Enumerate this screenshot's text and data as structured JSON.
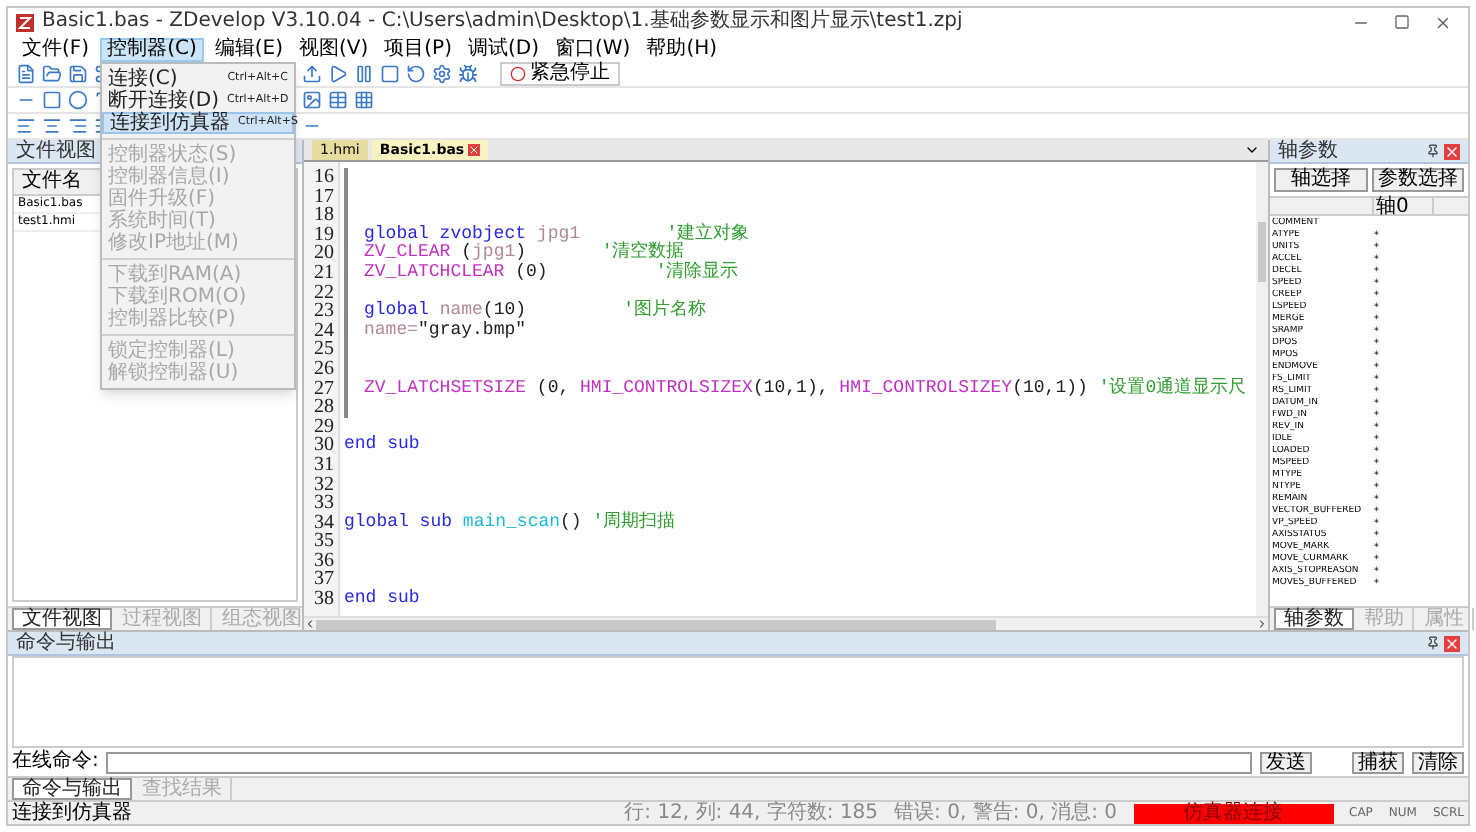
{
  "window": {
    "title": "Basic1.bas - ZDevelop V3.10.04 - C:\\Users\\admin\\Desktop\\1.基础参数显示和图片显示\\test1.zpj"
  },
  "menu_bar": [
    {
      "label": "文件(F)",
      "selected": false
    },
    {
      "label": "控制器(C)",
      "selected": true
    },
    {
      "label": "编辑(E)",
      "selected": false
    },
    {
      "label": "视图(V)",
      "selected": false
    },
    {
      "label": "项目(P)",
      "selected": false
    },
    {
      "label": "调试(D)",
      "selected": false
    },
    {
      "label": "窗口(W)",
      "selected": false
    },
    {
      "label": "帮助(H)",
      "selected": false
    }
  ],
  "dropdown_menu": {
    "groups": [
      [
        {
          "label": "连接(C)",
          "shortcut": "Ctrl+Alt+C",
          "disabled": false,
          "selected": false
        },
        {
          "label": "断开连接(D)",
          "shortcut": "Ctrl+Alt+D",
          "disabled": false,
          "selected": false
        },
        {
          "label": "连接到仿真器",
          "shortcut": "Ctrl+Alt+S",
          "disabled": false,
          "selected": true
        }
      ],
      [
        {
          "label": "控制器状态(S)",
          "disabled": true,
          "selected": false
        },
        {
          "label": "控制器信息(I)",
          "disabled": true,
          "selected": false
        },
        {
          "label": "固件升级(F)",
          "disabled": true,
          "selected": false
        },
        {
          "label": "系统时间(T)",
          "disabled": true,
          "selected": false
        },
        {
          "label": "修改IP地址(M)",
          "disabled": true,
          "selected": false
        }
      ],
      [
        {
          "label": "下载到RAM(A)",
          "disabled": true,
          "selected": false
        },
        {
          "label": "下载到ROM(O)",
          "disabled": true,
          "selected": false
        },
        {
          "label": "控制器比较(P)",
          "disabled": true,
          "selected": false
        }
      ],
      [
        {
          "label": "锁定控制器(L)",
          "disabled": true,
          "selected": false
        },
        {
          "label": "解锁控制器(U)",
          "disabled": true,
          "selected": false
        }
      ]
    ]
  },
  "toolbar": {
    "emergency_stop": "紧急停止"
  },
  "file_panel": {
    "title": "文件视图",
    "column": "文件名",
    "files": [
      "Basic1.bas",
      "test1.hmi"
    ],
    "tabs": [
      {
        "label": "文件视图",
        "selected": true
      },
      {
        "label": "过程视图",
        "selected": false
      },
      {
        "label": "组态视图",
        "selected": false
      }
    ]
  },
  "editor": {
    "tabs": [
      {
        "label": "1.hmi",
        "selected": false,
        "closable": false
      },
      {
        "label": "Basic1.bas",
        "selected": true,
        "closable": true
      }
    ],
    "lines": [
      {
        "number": "16",
        "indented": true
      },
      {
        "number": "17",
        "indented": true
      },
      {
        "number": "18",
        "indented": true
      },
      {
        "number": "19",
        "indented": true,
        "tokens": [
          {
            "text": "global zvobject ",
            "kind": "keyword"
          },
          {
            "text": "jpg1        ",
            "kind": "ident"
          },
          {
            "text": "'建立对象",
            "kind": "comment"
          }
        ]
      },
      {
        "number": "20",
        "indented": true,
        "tokens": [
          {
            "text": "ZV_CLEAR ",
            "kind": "function"
          },
          {
            "text": "(",
            "kind": "plain"
          },
          {
            "text": "jpg1",
            "kind": "ident"
          },
          {
            "text": ")       ",
            "kind": "plain"
          },
          {
            "text": "'清空数据",
            "kind": "comment"
          }
        ]
      },
      {
        "number": "21",
        "indented": true,
        "tokens": [
          {
            "text": "ZV_LATCHCLEAR ",
            "kind": "function"
          },
          {
            "text": "(0)          ",
            "kind": "plain"
          },
          {
            "text": "'清除显示",
            "kind": "comment"
          }
        ]
      },
      {
        "number": "22",
        "indented": true
      },
      {
        "number": "23",
        "indented": true,
        "tokens": [
          {
            "text": "global ",
            "kind": "keyword"
          },
          {
            "text": "name",
            "kind": "ident"
          },
          {
            "text": "(10)         ",
            "kind": "plain"
          },
          {
            "text": "'图片名称",
            "kind": "comment"
          }
        ]
      },
      {
        "number": "24",
        "indented": true,
        "tokens": [
          {
            "text": "name=",
            "kind": "ident"
          },
          {
            "text": "\"gray.bmp\"",
            "kind": "plain"
          }
        ]
      },
      {
        "number": "25",
        "indented": true
      },
      {
        "number": "26",
        "indented": true
      },
      {
        "number": "27",
        "indented": true,
        "tokens": [
          {
            "text": "ZV_LATCHSETSIZE ",
            "kind": "function"
          },
          {
            "text": "(0, ",
            "kind": "plain"
          },
          {
            "text": "HMI_CONTROLSIZEX",
            "kind": "function"
          },
          {
            "text": "(10,1), ",
            "kind": "plain"
          },
          {
            "text": "HMI_CONTROLSIZEY",
            "kind": "function"
          },
          {
            "text": "(10,1)) ",
            "kind": "plain"
          },
          {
            "text": "'设置0通道显示尺",
            "kind": "comment"
          }
        ]
      },
      {
        "number": "28",
        "indented": true
      },
      {
        "number": "29",
        "indented": false
      },
      {
        "number": "30",
        "indented": false,
        "tokens": [
          {
            "text": "end sub",
            "kind": "keyword"
          }
        ]
      },
      {
        "number": "31",
        "indented": false
      },
      {
        "number": "32",
        "indented": false
      },
      {
        "number": "33",
        "indented": false
      },
      {
        "number": "34",
        "indented": false,
        "tokens": [
          {
            "text": "global sub ",
            "kind": "keyword"
          },
          {
            "text": "main_scan",
            "kind": "name"
          },
          {
            "text": "() ",
            "kind": "plain"
          },
          {
            "text": "'周期扫描",
            "kind": "comment"
          }
        ]
      },
      {
        "number": "35",
        "indented": false
      },
      {
        "number": "36",
        "indented": false
      },
      {
        "number": "37",
        "indented": false
      },
      {
        "number": "38",
        "indented": false,
        "tokens": [
          {
            "text": "end sub",
            "kind": "keyword"
          }
        ]
      }
    ]
  },
  "axis_panel": {
    "title": "轴参数",
    "buttons": [
      "轴选择",
      "参数选择"
    ],
    "column": "轴0",
    "params": [
      {
        "name": "COMMENT"
      },
      {
        "name": "ATYPE",
        "value": "*"
      },
      {
        "name": "UNITS",
        "value": "*"
      },
      {
        "name": "ACCEL",
        "value": "*"
      },
      {
        "name": "DECEL",
        "value": "*"
      },
      {
        "name": "SPEED",
        "value": "*"
      },
      {
        "name": "CREEP",
        "value": "*"
      },
      {
        "name": "LSPEED",
        "value": "*"
      },
      {
        "name": "MERGE",
        "value": "*"
      },
      {
        "name": "SRAMP",
        "value": "*"
      },
      {
        "name": "DPOS",
        "value": "*"
      },
      {
        "name": "MPOS",
        "value": "*"
      },
      {
        "name": "ENDMOVE",
        "value": "*"
      },
      {
        "name": "FS_LIMIT",
        "value": "*"
      },
      {
        "name": "RS_LIMIT",
        "value": "*"
      },
      {
        "name": "DATUM_IN",
        "value": "*"
      },
      {
        "name": "FWD_IN",
        "value": "*"
      },
      {
        "name": "REV_IN",
        "value": "*"
      },
      {
        "name": "IDLE",
        "value": "*"
      },
      {
        "name": "LOADED",
        "value": "*"
      },
      {
        "name": "MSPEED",
        "value": "*"
      },
      {
        "name": "MTYPE",
        "value": "*"
      },
      {
        "name": "NTYPE",
        "value": "*"
      },
      {
        "name": "REMAIN",
        "value": "*"
      },
      {
        "name": "VECTOR_BUFFERED",
        "value": "*"
      },
      {
        "name": "VP_SPEED",
        "value": "*"
      },
      {
        "name": "AXISSTATUS",
        "value": "*"
      },
      {
        "name": "MOVE_MARK",
        "value": "*"
      },
      {
        "name": "MOVE_CURMARK",
        "value": "*"
      },
      {
        "name": "AXIS_STOPREASON",
        "value": "*"
      },
      {
        "name": "MOVES_BUFFERED",
        "value": "*"
      }
    ],
    "tabs": [
      {
        "label": "轴参数",
        "selected": true
      },
      {
        "label": "帮助",
        "selected": false
      },
      {
        "label": "属性",
        "selected": false
      }
    ]
  },
  "output_panel": {
    "title": "命令与输出",
    "command_label": "在线命令:",
    "buttons": [
      "发送",
      "捕获",
      "清除"
    ],
    "tabs": [
      {
        "label": "命令与输出",
        "selected": true
      },
      {
        "label": "查找结果",
        "selected": false
      }
    ]
  },
  "status_bar": {
    "message": "连接到仿真器",
    "position": "行: 12, 列: 44, 字符数: 185",
    "diagnostics": "错误: 0, 警告: 0, 消息: 0",
    "connection": "仿真器连接",
    "indicators": [
      "CAP",
      "NUM",
      "SCRL"
    ]
  }
}
